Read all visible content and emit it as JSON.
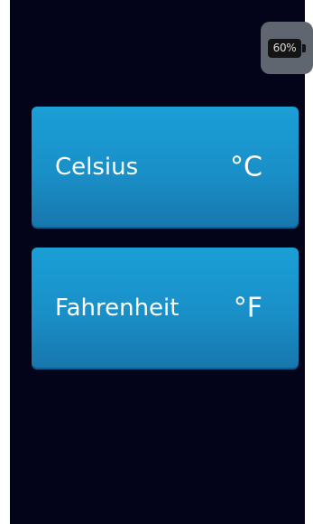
{
  "status": {
    "battery_percent_label": "60%",
    "battery_level": 60
  },
  "units": {
    "celsius": {
      "label": "Celsius",
      "symbol": "°C"
    },
    "fahrenheit": {
      "label": "Fahrenheit",
      "symbol": "°F"
    }
  },
  "colors": {
    "background": "#03041a",
    "button_blue": "#1a8fc8",
    "battery_button": "#5f6670"
  }
}
